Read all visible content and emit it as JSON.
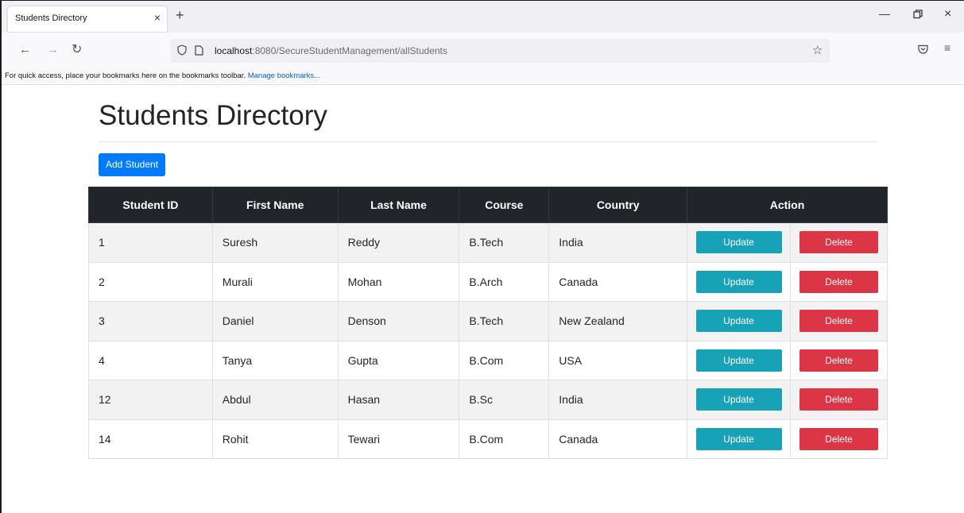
{
  "browser": {
    "tab_title": "Students Directory",
    "tab_close": "×",
    "new_tab": "+",
    "url_host": "localhost",
    "url_path": ":8080/SecureStudentManagement/allStudents",
    "bookmarks_text": "For quick access, place your bookmarks here on the bookmarks toolbar. ",
    "bookmarks_link": "Manage bookmarks..."
  },
  "page": {
    "title": "Students Directory",
    "add_button": "Add Student"
  },
  "table": {
    "headers": [
      "Student ID",
      "First Name",
      "Last Name",
      "Course",
      "Country",
      "Action"
    ],
    "rows": [
      {
        "id": "1",
        "first": "Suresh",
        "last": "Reddy",
        "course": "B.Tech",
        "country": "India"
      },
      {
        "id": "2",
        "first": "Murali",
        "last": "Mohan",
        "course": "B.Arch",
        "country": "Canada"
      },
      {
        "id": "3",
        "first": "Daniel",
        "last": "Denson",
        "course": "B.Tech",
        "country": "New Zealand"
      },
      {
        "id": "4",
        "first": "Tanya",
        "last": "Gupta",
        "course": "B.Com",
        "country": "USA"
      },
      {
        "id": "12",
        "first": "Abdul",
        "last": "Hasan",
        "course": "B.Sc",
        "country": "India"
      },
      {
        "id": "14",
        "first": "Rohit",
        "last": "Tewari",
        "course": "B.Com",
        "country": "Canada"
      }
    ],
    "update_label": "Update",
    "delete_label": "Delete"
  },
  "colors": {
    "primary": "#007bff",
    "info": "#17a2b8",
    "danger": "#dc3545",
    "header_dark": "#212529"
  }
}
